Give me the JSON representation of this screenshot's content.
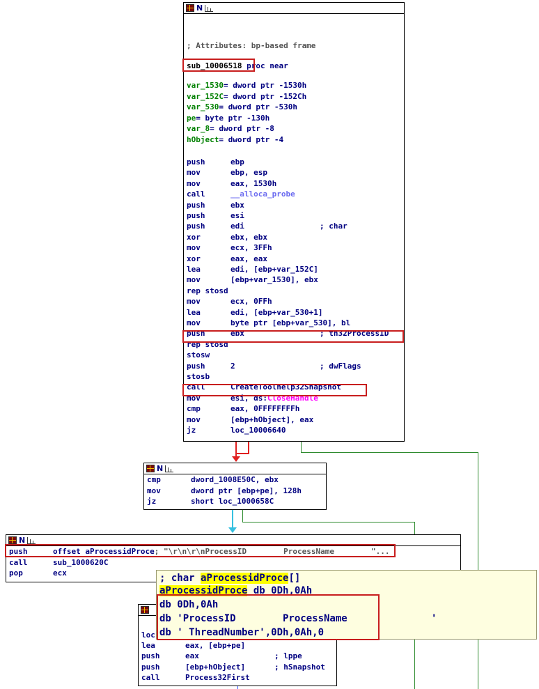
{
  "colors": {
    "code": "#000080",
    "var": "#008000",
    "string_func": "#ff00ff",
    "func": "#6c6cf0",
    "highlight_box": "#c81e1e",
    "edge_true": "#2e8b2e",
    "edge_false": "#e02020",
    "edge_next": "#36c0e0"
  },
  "node_header_icons": [
    "grid-icon",
    "n-icon",
    "graph-icon"
  ],
  "node1": {
    "attr_comment": "; Attributes: bp-based frame",
    "proc_name": "sub_10006518",
    "proc_kw": " proc near",
    "vars": [
      {
        "name": "var_1530",
        "def": "= dword ptr -1530h"
      },
      {
        "name": "var_152C",
        "def": "= dword ptr -152Ch"
      },
      {
        "name": "var_530",
        "def": "= dword ptr -530h"
      },
      {
        "name": "pe",
        "def": "= byte ptr -130h"
      },
      {
        "name": "var_8",
        "def": "= dword ptr -8"
      },
      {
        "name": "hObject",
        "def": "= dword ptr -4"
      }
    ],
    "code": [
      {
        "op": "push",
        "args": "ebp",
        "cmt": ""
      },
      {
        "op": "mov",
        "args": "ebp, esp",
        "cmt": ""
      },
      {
        "op": "mov",
        "args": "eax, 1530h",
        "cmt": ""
      },
      {
        "op": "call",
        "args": "__alloca_probe",
        "cmt": ""
      },
      {
        "op": "push",
        "args": "ebx",
        "cmt": ""
      },
      {
        "op": "push",
        "args": "esi",
        "cmt": ""
      },
      {
        "op": "push",
        "args": "edi",
        "cmt": "; char"
      },
      {
        "op": "xor",
        "args": "ebx, ebx",
        "cmt": ""
      },
      {
        "op": "mov",
        "args": "ecx, 3FFh",
        "cmt": ""
      },
      {
        "op": "xor",
        "args": "eax, eax",
        "cmt": ""
      },
      {
        "op": "lea",
        "args": "edi, [ebp+var_152C]",
        "cmt": ""
      },
      {
        "op": "mov",
        "args": "[ebp+var_1530], ebx",
        "cmt": ""
      },
      {
        "op": "rep stosd",
        "args": "",
        "cmt": ""
      },
      {
        "op": "mov",
        "args": "ecx, 0FFh",
        "cmt": ""
      },
      {
        "op": "lea",
        "args": "edi, [ebp+var_530+1]",
        "cmt": ""
      },
      {
        "op": "mov",
        "args": "byte ptr [ebp+var_530], bl",
        "cmt": ""
      },
      {
        "op": "push",
        "args": "ebx",
        "cmt": "; th32ProcessID"
      },
      {
        "op": "rep stosd",
        "args": "",
        "cmt": ""
      },
      {
        "op": "stosw",
        "args": "",
        "cmt": ""
      },
      {
        "op": "push",
        "args": "2",
        "cmt": "; dwFlags"
      },
      {
        "op": "stosb",
        "args": "",
        "cmt": ""
      },
      {
        "op": "call",
        "args": "CreateToolhelp32Snapshot",
        "cmt": ""
      },
      {
        "op": "mov",
        "args": "esi, ds:CloseHandle",
        "cmt": ""
      },
      {
        "op": "cmp",
        "args": "eax, 0FFFFFFFFh",
        "cmt": ""
      },
      {
        "op": "mov",
        "args": "[ebp+hObject], eax",
        "cmt": ""
      },
      {
        "op": "jz",
        "args": "loc_10006640",
        "cmt": ""
      }
    ]
  },
  "node2": {
    "code": [
      {
        "op": "cmp",
        "args": "dword_1008E50C, ebx"
      },
      {
        "op": "mov",
        "args": "dword ptr [ebp+pe], 128h"
      },
      {
        "op": "jz",
        "args": "short loc_1000658C"
      }
    ]
  },
  "node3": {
    "code": [
      {
        "op": "push",
        "args": "offset aProcessidProce",
        "cmt": "; \"\\r\\n\\r\\nProcessID        ProcessName        \"..."
      },
      {
        "op": "call",
        "args": "sub_1000620C",
        "cmt": ""
      },
      {
        "op": "pop",
        "args": "ecx",
        "cmt": ""
      }
    ]
  },
  "node4": {
    "label": "loc",
    "code": [
      {
        "op": "lea",
        "args": "eax, [ebp+pe]",
        "cmt": ""
      },
      {
        "op": "push",
        "args": "eax",
        "cmt": "; lppe"
      },
      {
        "op": "push",
        "args": "[ebp+hObject]",
        "cmt": "; hSnapshot"
      },
      {
        "op": "call",
        "args": "Process32First",
        "cmt": ""
      }
    ]
  },
  "popup": {
    "l1_prefix": "; char ",
    "l1_name": "aProcessidProce",
    "l1_suffix": "[]",
    "l2_name": "aProcessidProce",
    "l2_rest": " db 0Dh,0Ah",
    "l3": "db 0Dh,0Ah",
    "l4": "db 'ProcessID        ProcessName",
    "l4_dot": "'",
    "l5": "db ' ThreadNumber',0Dh,0Ah,0"
  }
}
